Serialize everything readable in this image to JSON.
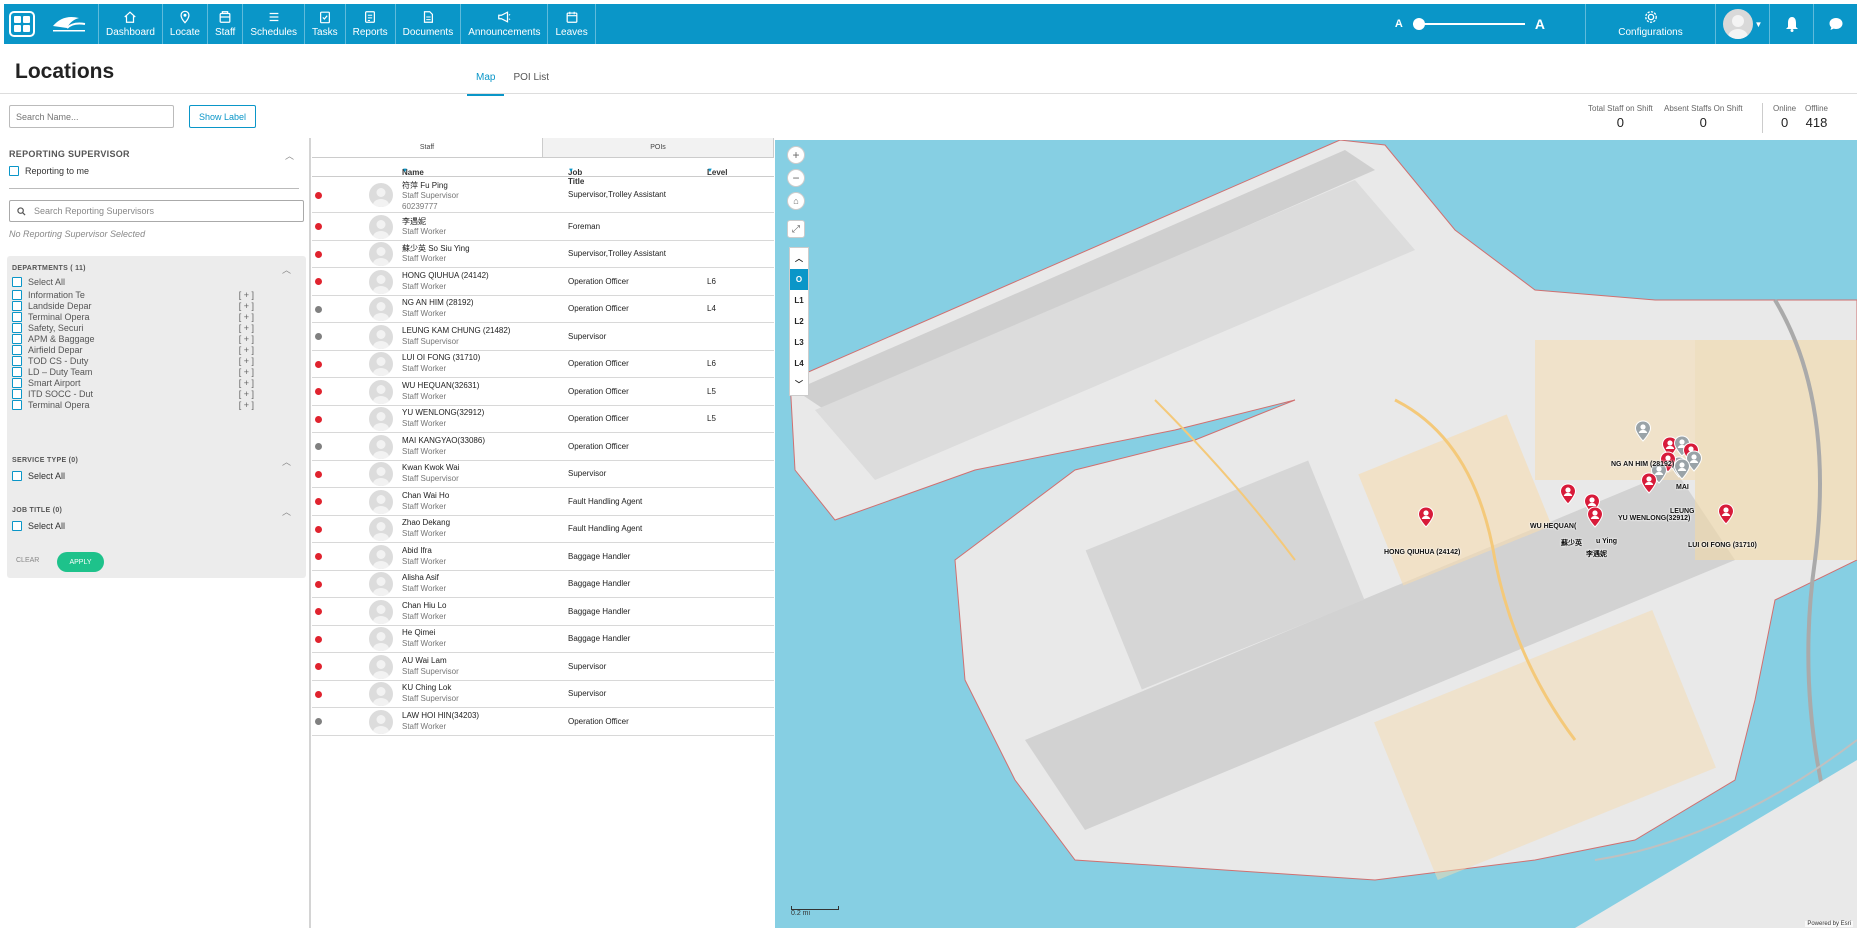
{
  "nav": {
    "items": [
      {
        "label": "Dashboard",
        "icon": "home-icon"
      },
      {
        "label": "Locate",
        "icon": "location-pin-icon"
      },
      {
        "label": "Staff",
        "icon": "staff-icon"
      },
      {
        "label": "Schedules",
        "icon": "list-icon"
      },
      {
        "label": "Tasks",
        "icon": "clipboard-icon"
      },
      {
        "label": "Reports",
        "icon": "report-icon"
      },
      {
        "label": "Documents",
        "icon": "document-icon"
      },
      {
        "label": "Announcements",
        "icon": "megaphone-icon"
      },
      {
        "label": "Leaves",
        "icon": "calendar-icon"
      }
    ],
    "font_small": "A",
    "font_large": "A",
    "font_size_level": 0,
    "configurations": "Configurations",
    "brand_color": "#0a96c8"
  },
  "page": {
    "title": "Locations",
    "tabs": [
      "Map",
      "POI List"
    ],
    "active_tab": "Map",
    "search_placeholder": "Search Name...",
    "show_label": "Show Label"
  },
  "stats": {
    "total_label": "Total Staff on Shift",
    "total_value": "0",
    "absent_label": "Absent Staffs On Shift",
    "absent_value": "0",
    "online_label": "Online",
    "online_value": "0",
    "offline_label": "Offline",
    "offline_value": "418"
  },
  "filters": {
    "reporting_title": "REPORTING SUPERVISOR",
    "reporting_to_me": "Reporting to me",
    "supervisor_search_placeholder": "Search Reporting Supervisors",
    "no_supervisor": "No Reporting Supervisor Selected",
    "departments_title": "DEPARTMENTS ( 11)",
    "select_all": "Select All",
    "departments": [
      "Information Te",
      "Landside Depar",
      "Terminal Opera",
      "Safety, Securi",
      "APM & Baggage",
      "Airfield Depar",
      "TOD CS - Duty",
      "LD – Duty Team",
      "Smart Airport",
      "ITD SOCC - Dut",
      "Terminal Opera"
    ],
    "expand": "[ + ]",
    "service_type_title": "SERVICE TYPE (0)",
    "job_title_title": "JOB TITLE (0)",
    "clear": "CLEAR",
    "apply": "APPLY"
  },
  "table": {
    "tabs": [
      "Staff",
      "POIs"
    ],
    "active_tab": "Staff",
    "columns": [
      "Name",
      "Job Title",
      "Level"
    ],
    "status_colors": {
      "offline": "#e0232e",
      "idle": "#808080"
    },
    "rows": [
      {
        "name": "符萍 Fu Ping",
        "role": "Staff Supervisor",
        "extra": "60239777",
        "job": "Supervisor,Trolley Assistant",
        "level": "",
        "status": "offline"
      },
      {
        "name": "李遇妮",
        "role": "Staff Worker",
        "extra": "",
        "job": "Foreman",
        "level": "",
        "status": "offline"
      },
      {
        "name": "蘇少英 So Siu Ying",
        "role": "Staff Worker",
        "extra": "",
        "job": "Supervisor,Trolley Assistant",
        "level": "",
        "status": "offline"
      },
      {
        "name": "HONG QIUHUA (24142)",
        "role": "Staff Worker",
        "extra": "",
        "job": "Operation Officer",
        "level": "L6",
        "status": "offline"
      },
      {
        "name": "NG AN HIM (28192)",
        "role": "Staff Worker",
        "extra": "",
        "job": "Operation Officer",
        "level": "L4",
        "status": "idle"
      },
      {
        "name": "LEUNG KAM CHUNG (21482)",
        "role": "Staff Supervisor",
        "extra": "",
        "job": "Supervisor",
        "level": "",
        "status": "idle"
      },
      {
        "name": "LUI OI FONG (31710)",
        "role": "Staff Worker",
        "extra": "",
        "job": "Operation Officer",
        "level": "L6",
        "status": "offline"
      },
      {
        "name": "WU HEQUAN(32631)",
        "role": "Staff Worker",
        "extra": "",
        "job": "Operation Officer",
        "level": "L5",
        "status": "offline"
      },
      {
        "name": "YU WENLONG(32912)",
        "role": "Staff Worker",
        "extra": "",
        "job": "Operation Officer",
        "level": "L5",
        "status": "offline"
      },
      {
        "name": "MAI KANGYAO(33086)",
        "role": "Staff Worker",
        "extra": "",
        "job": "Operation Officer",
        "level": "",
        "status": "idle"
      },
      {
        "name": "Kwan Kwok Wai",
        "role": "Staff Supervisor",
        "extra": "",
        "job": "Supervisor",
        "level": "",
        "status": "offline"
      },
      {
        "name": "Chan Wai Ho",
        "role": "Staff Worker",
        "extra": "",
        "job": "Fault Handling Agent",
        "level": "",
        "status": "offline"
      },
      {
        "name": "Zhao Dekang",
        "role": "Staff Worker",
        "extra": "",
        "job": "Fault Handling Agent",
        "level": "",
        "status": "offline"
      },
      {
        "name": "Abid Ifra",
        "role": "Staff Worker",
        "extra": "",
        "job": "Baggage Handler",
        "level": "",
        "status": "offline"
      },
      {
        "name": "Alisha Asif",
        "role": "Staff Worker",
        "extra": "",
        "job": "Baggage Handler",
        "level": "",
        "status": "offline"
      },
      {
        "name": "Chan Hiu Lo",
        "role": "Staff Worker",
        "extra": "",
        "job": "Baggage Handler",
        "level": "",
        "status": "offline"
      },
      {
        "name": "He Qimei",
        "role": "Staff Worker",
        "extra": "",
        "job": "Baggage Handler",
        "level": "",
        "status": "offline"
      },
      {
        "name": "AU Wai Lam",
        "role": "Staff Supervisor",
        "extra": "",
        "job": "Supervisor",
        "level": "",
        "status": "offline"
      },
      {
        "name": "KU Ching Lok",
        "role": "Staff Supervisor",
        "extra": "",
        "job": "Supervisor",
        "level": "",
        "status": "offline"
      },
      {
        "name": "LAW HOI HIN(34203)",
        "role": "Staff Worker",
        "extra": "",
        "job": "Operation Officer",
        "level": "",
        "status": "idle"
      }
    ]
  },
  "map": {
    "floors": [
      "O",
      "L1",
      "L2",
      "L3",
      "L4"
    ],
    "active_floor": "O",
    "labels": {
      "hong": "HONG QIUHUA (24142)",
      "ng": "NG AN HIM (28192)",
      "yu": "YU WENLONG(32912)",
      "lui": "LUI OI FONG (31710)",
      "wu": "WU HEQUAN(",
      "so": "蘇少英",
      "so2": "u Ying",
      "li": "李遇妮",
      "mai": "MAI",
      "leung": "LEUNG"
    },
    "scale": "0.2 mi",
    "attribution": "Powered by Esri",
    "water_color": "#86cfe3",
    "land_color": "#e9e9e9"
  }
}
